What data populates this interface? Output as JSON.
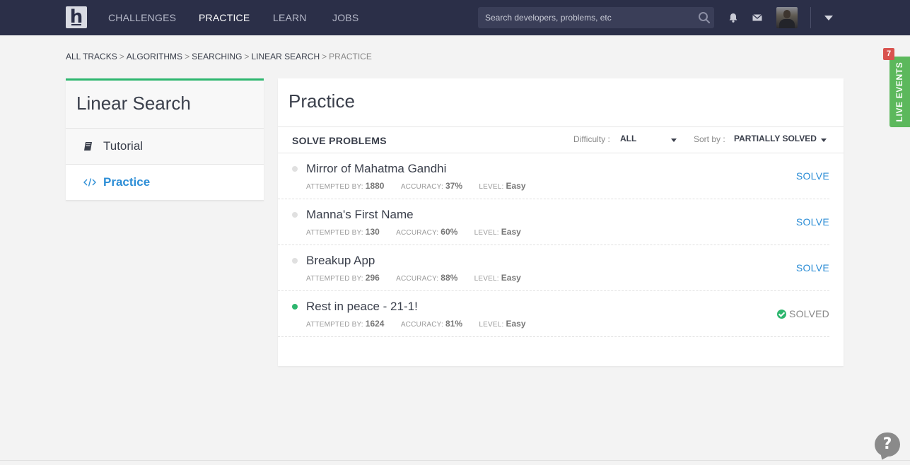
{
  "nav": {
    "logo_letter": "h",
    "links": [
      "CHALLENGES",
      "PRACTICE",
      "LEARN",
      "JOBS"
    ],
    "active_link": "PRACTICE",
    "search_placeholder": "Search developers, problems, etc",
    "icons": [
      "search-icon",
      "bell-icon",
      "mail-icon",
      "chevron-down-icon"
    ]
  },
  "breadcrumb": {
    "items": [
      "ALL TRACKS",
      "ALGORITHMS",
      "SEARCHING",
      "LINEAR SEARCH"
    ],
    "separator": ">",
    "current": "PRACTICE"
  },
  "sidebar": {
    "title": "Linear Search",
    "items": [
      {
        "label": "Tutorial",
        "icon": "book-icon"
      },
      {
        "label": "Practice",
        "icon": "code-icon"
      }
    ]
  },
  "main": {
    "title": "Practice",
    "section_label": "SOLVE PROBLEMS",
    "difficulty_label": "Difficulty :",
    "difficulty_value": "ALL",
    "sort_label": "Sort by :",
    "sort_value": "PARTIALLY SOLVED",
    "meta_keys": {
      "attempted": "ATTEMPTED BY:",
      "accuracy": "ACCURACY:",
      "level": "LEVEL:"
    },
    "problems": [
      {
        "name": "Mirror of Mahatma Gandhi",
        "attempted": "1880",
        "accuracy": "37%",
        "level": "Easy",
        "action": "SOLVE",
        "solved": false
      },
      {
        "name": "Manna's First Name",
        "attempted": "130",
        "accuracy": "60%",
        "level": "Easy",
        "action": "SOLVE",
        "solved": false
      },
      {
        "name": "Breakup App",
        "attempted": "296",
        "accuracy": "88%",
        "level": "Easy",
        "action": "SOLVE",
        "solved": false
      },
      {
        "name": "Rest in peace - 21-1!",
        "attempted": "1624",
        "accuracy": "81%",
        "level": "Easy",
        "action": "SOLVED",
        "solved": true
      }
    ]
  },
  "live_events": {
    "label": "LIVE EVENTS",
    "badge": "7"
  },
  "help": {
    "label": "?"
  },
  "colors": {
    "nav_bg": "#2b2f48",
    "accent_green": "#2db66e",
    "link_blue": "#2d8ed6",
    "badge_red": "#d9534f",
    "live_green": "#5cb85c"
  }
}
